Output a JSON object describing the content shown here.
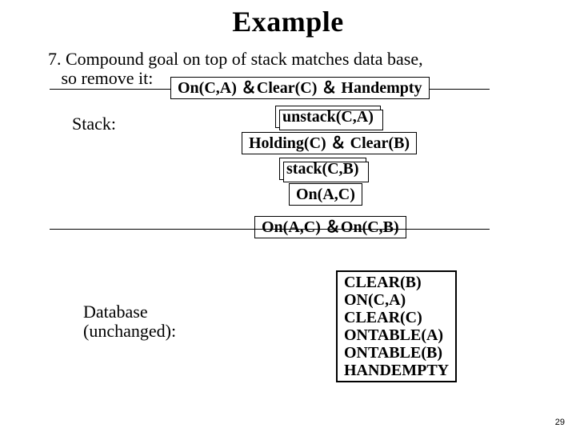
{
  "title": "Example",
  "bullet_num": "7.",
  "bullet_text_line1": "Compound goal on top of stack matches data base,",
  "bullet_text_line2": "so remove it:",
  "stack_label": "Stack:",
  "stack": {
    "top": "On(C,A) ＆Clear(C) ＆ Handempty",
    "s1": "unstack(C,A)",
    "s2": "Holding(C) ＆ Clear(B)",
    "s3": "stack(C,B)",
    "s4": "On(A,C)",
    "goal": "On(A,C) ＆On(C,B)"
  },
  "db_label_line1": "Database",
  "db_label_line2": "(unchanged):",
  "database": [
    "CLEAR(B)",
    "ON(C,A)",
    "CLEAR(C)",
    "ONTABLE(A)",
    "ONTABLE(B)",
    "HANDEMPTY"
  ],
  "page": "29"
}
